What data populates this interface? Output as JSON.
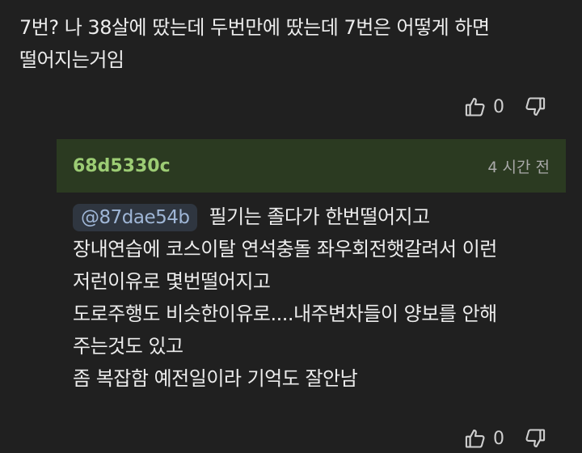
{
  "comment": {
    "text_line1": "7번? 나 38살에 땄는데 두번만에 땄는데 7번은 어떻게 하면",
    "text_line2": "떨어지는거임",
    "like_count": "0"
  },
  "reply": {
    "author": "68d5330c",
    "time": "4 시간 전",
    "mention": "@87dae54b",
    "lines": [
      "필기는 졸다가 한번떨어지고",
      "장내연습에 코스이탈 연석충돌 좌우회전햇갈려서 이런",
      "저런이유로 몇번떨어지고",
      "도로주행도 비슷한이유로....내주변차들이 양보를 안해",
      "주는것도 있고",
      "좀 복잡함 예전일이라 기억도 잘안남"
    ],
    "like_count": "0"
  },
  "icons": {
    "like": "thumbs-up-icon",
    "dislike": "thumbs-down-icon"
  },
  "colors": {
    "background": "#202020",
    "reply_header_bg": "#2b3a21",
    "author": "#9ccc74",
    "mention_bg": "#2f3640",
    "mention_text": "#9fb6d6"
  }
}
